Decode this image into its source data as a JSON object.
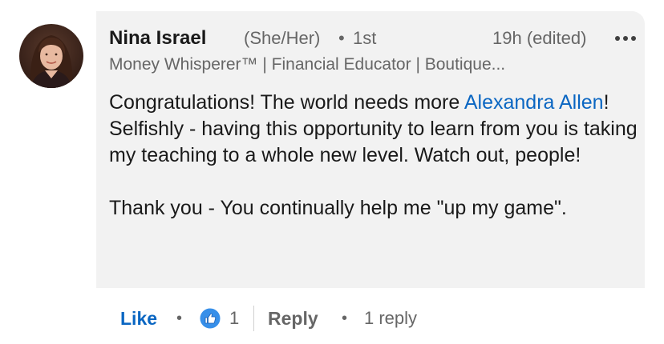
{
  "comment": {
    "author": {
      "name": "Nina Israel",
      "pronouns": "(She/Her)",
      "separator": "•",
      "connection_degree": "1st",
      "headline": "Money Whisperer™ | Financial Educator | Boutique..."
    },
    "timestamp": "19h (edited)",
    "more_icon": "more-horizontal-icon",
    "body": {
      "line1_prefix": "Congratulations! The world needs more ",
      "mention": "Alexandra Allen",
      "line1_suffix": "! Selfishly - having this opportunity to learn from you is taking my teaching to a whole new level. Watch out, people!",
      "paragraph2": "Thank you - You continually help me \"up my game\"."
    }
  },
  "actions": {
    "like_label": "Like",
    "separator": "•",
    "reaction_icon": "thumbs-up-icon",
    "reaction_count": "1",
    "reply_label": "Reply",
    "reply_count": "1 reply"
  },
  "colors": {
    "link_blue": "#0a66c2",
    "bubble_bg": "#f2f2f2",
    "text_primary": "#191919",
    "text_secondary": "#666666"
  }
}
